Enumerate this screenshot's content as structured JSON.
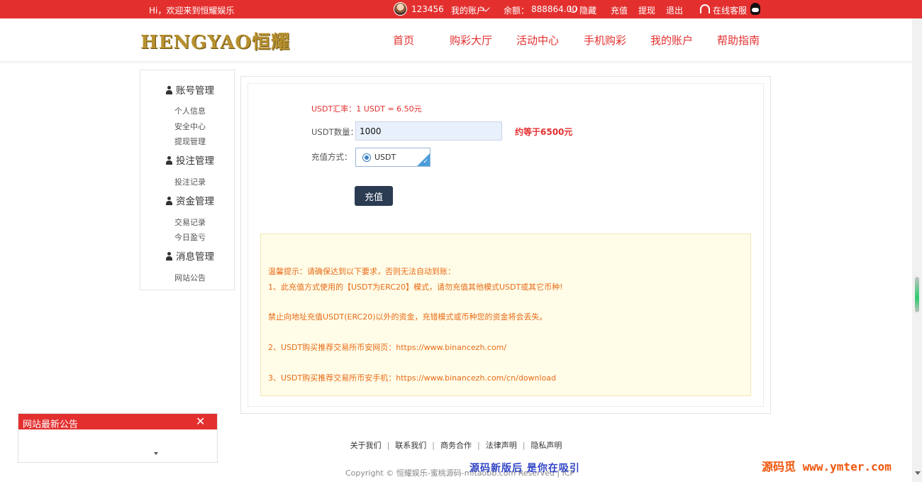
{
  "topbar": {
    "welcome": "Hi，欢迎来到恒耀娱乐",
    "username": "123456",
    "my_account": "我的账户",
    "balance_label": "余额：",
    "balance_value": "888864.00",
    "hide": "隐藏",
    "recharge": "充值",
    "withdraw": "提现",
    "logout": "退出",
    "online_service": "在线客服"
  },
  "header": {
    "logo": "HENGYAO恒耀",
    "nav": [
      "首页",
      "购彩大厅",
      "活动中心",
      "手机购彩",
      "我的账户",
      "帮助指南"
    ]
  },
  "sidebar": {
    "sections": [
      {
        "title": "账号管理",
        "items": [
          "个人信息",
          "安全中心",
          "提现管理"
        ]
      },
      {
        "title": "投注管理",
        "items": [
          "投注记录"
        ]
      },
      {
        "title": "资金管理",
        "items": [
          "交易记录",
          "今日盈亏"
        ]
      },
      {
        "title": "消息管理",
        "items": [
          "网站公告"
        ]
      }
    ]
  },
  "form": {
    "rate": "USDT汇率：1 USDT = 6.50元",
    "qty_label": "USDT数量：",
    "qty_value": "1000",
    "approx": "约等于6500元",
    "method_label": "充值方式：",
    "method_option": "USDT",
    "submit": "充值"
  },
  "notice": {
    "lines": [
      "温馨提示：请确保达到以下要求，否则无法自动到账：",
      "1、此充值方式使用的【USDT为ERC20】模式，请勿充值其他模式USDT或其它币种!",
      "禁止向地址充值USDT(ERC20)以外的资金，充错模式或币种您的资金将会丢失。",
      "2、USDT购买推荐交易所币安网页：https://www.binancezh.com/",
      "3、USDT购买推荐交易所币安手机：https://www.binancezh.com/cn/download"
    ]
  },
  "footer": {
    "links": [
      "关于我们",
      "联系我们",
      "商务合作",
      "法律声明",
      "隐私声明"
    ],
    "copyright": "Copyright © 恒耀娱乐-蜜桃源码-mitaobb.com Reserved | ICP",
    "watermark_center": "源码新版后 是你在吸引",
    "watermark_right": "源码觅 www.ymter.com"
  },
  "popup": {
    "title": "网站最新公告",
    "close": "✕"
  }
}
